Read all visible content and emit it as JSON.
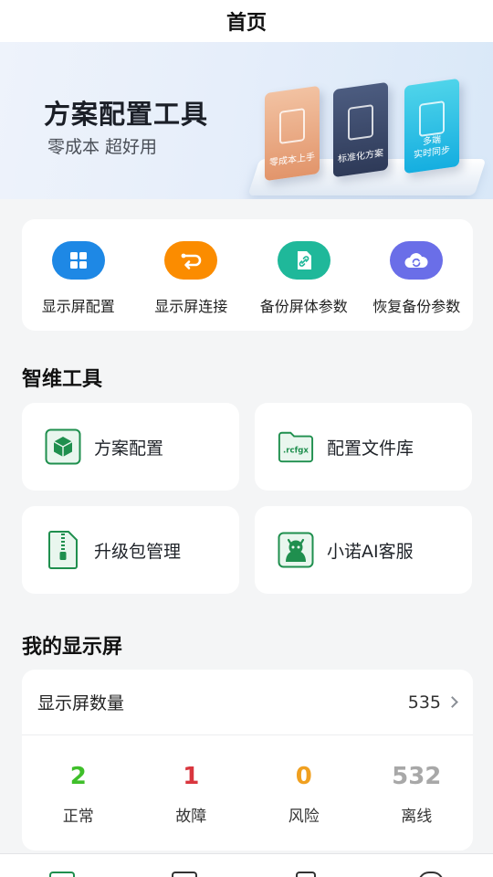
{
  "header": {
    "title": "首页"
  },
  "banner": {
    "title": "方案配置工具",
    "subtitle": "零成本 超好用",
    "cards": [
      {
        "label": "零成本上手",
        "icon": "dollar-doc-icon"
      },
      {
        "label": "标准化方案",
        "icon": "gear-doc-icon"
      },
      {
        "label": "多端\n实时同步",
        "icon": "screens-icon"
      }
    ]
  },
  "quick_actions": [
    {
      "label": "显示屏配置",
      "icon": "grid-icon",
      "color": "#1e88e5"
    },
    {
      "label": "显示屏连接",
      "icon": "link-arrows-icon",
      "color": "#fb8c00"
    },
    {
      "label": "备份屏体参数",
      "icon": "file-link-icon",
      "color": "#1fb89a"
    },
    {
      "label": "恢复备份参数",
      "icon": "cloud-sync-icon",
      "color": "#6a6ee8"
    }
  ],
  "tools_section": {
    "title": "智维工具",
    "items": [
      {
        "label": "方案配置",
        "icon": "cube-icon"
      },
      {
        "label": "配置文件库",
        "icon": "folder-rcfgx-icon",
        "badge": ".rcfgx"
      },
      {
        "label": "升级包管理",
        "icon": "zip-file-icon"
      },
      {
        "label": "小诺AI客服",
        "icon": "robot-icon"
      }
    ]
  },
  "my_screens": {
    "title": "我的显示屏",
    "count_label": "显示屏数量",
    "count": "535",
    "stats": [
      {
        "value": "2",
        "label": "正常",
        "color": "#3fbf2a"
      },
      {
        "value": "1",
        "label": "故障",
        "color": "#d9363e"
      },
      {
        "value": "0",
        "label": "风险",
        "color": "#f0a020"
      },
      {
        "value": "532",
        "label": "离线",
        "color": "#a8a8a8"
      }
    ]
  },
  "colors": {
    "brand_green": "#1f8f4e",
    "accent_blue": "#1e88e5"
  }
}
